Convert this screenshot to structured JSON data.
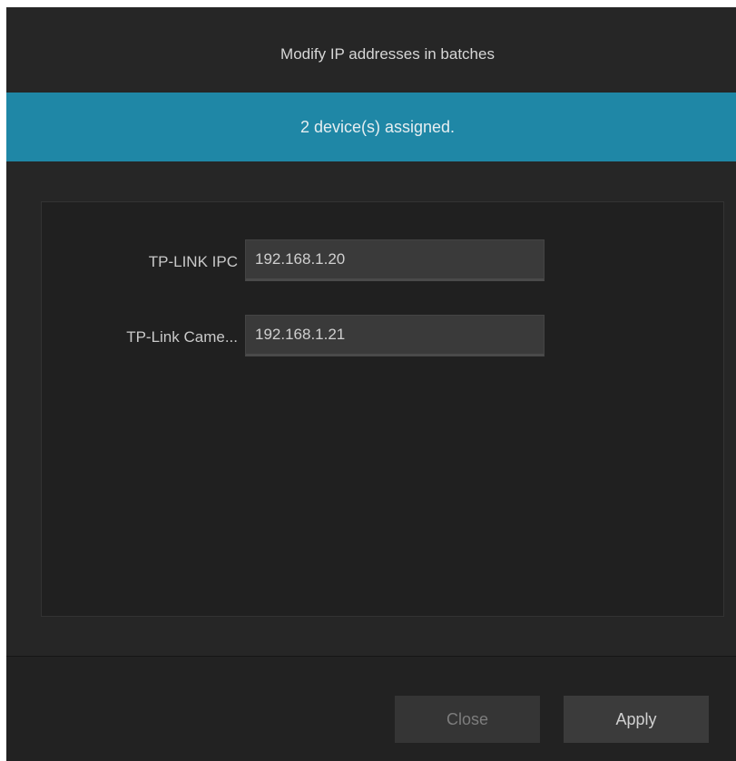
{
  "dialog": {
    "title": "Modify IP addresses in batches",
    "banner": "2 device(s) assigned.",
    "devices": [
      {
        "label": "TP-LINK IPC",
        "ip": "192.168.1.20"
      },
      {
        "label": "TP-Link Came...",
        "ip": "192.168.1.21"
      }
    ],
    "buttons": {
      "close_label": "Close",
      "apply_label": "Apply"
    }
  },
  "colors": {
    "background": "#262626",
    "banner": "#1f87a6",
    "panel": "#202020",
    "field": "#3a3a3a"
  }
}
